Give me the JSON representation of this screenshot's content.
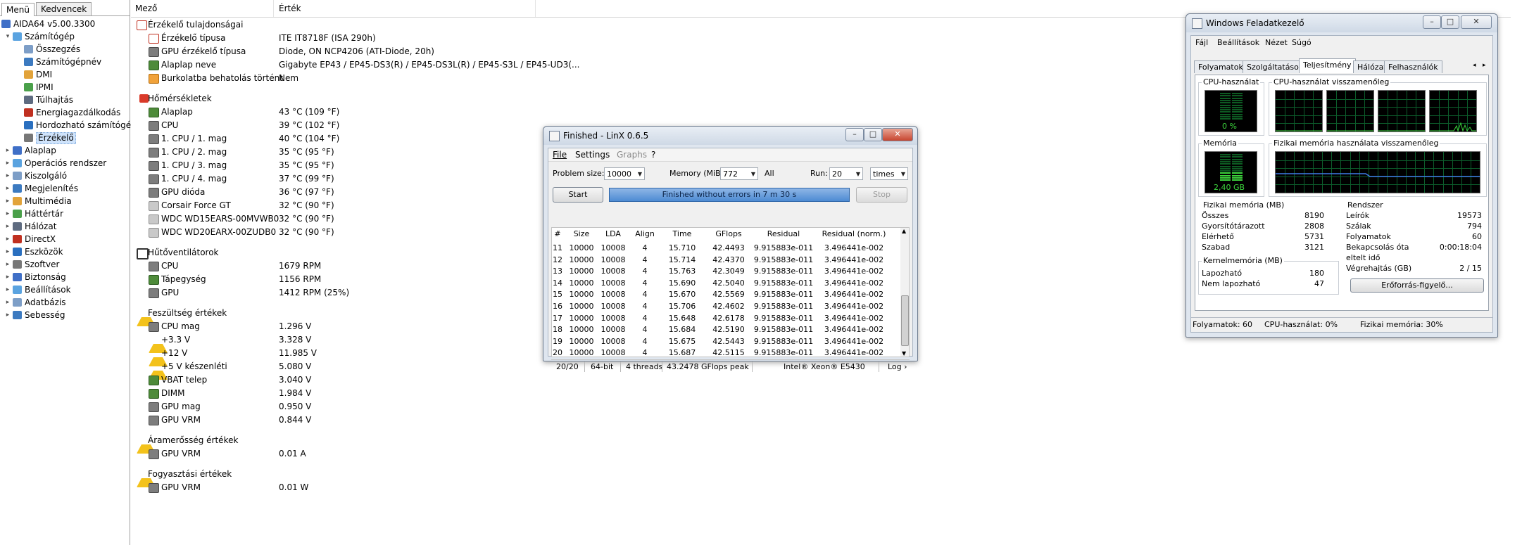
{
  "left": {
    "tabs": [
      "Menü",
      "Kedvencek"
    ],
    "tree": [
      {
        "label": "AIDA64 v5.00.3300",
        "level": 0,
        "icon": "aida64-icon",
        "exp": ""
      },
      {
        "label": "Számítógép",
        "level": 1,
        "icon": "computer-icon",
        "exp": "▾"
      },
      {
        "label": "Összegzés",
        "level": 2,
        "icon": "summary-icon",
        "exp": ""
      },
      {
        "label": "Számítógépnév",
        "level": 2,
        "icon": "computer-name-icon",
        "exp": ""
      },
      {
        "label": "DMI",
        "level": 2,
        "icon": "dmi-icon",
        "exp": ""
      },
      {
        "label": "IPMI",
        "level": 2,
        "icon": "ipmi-icon",
        "exp": ""
      },
      {
        "label": "Túlhajtás",
        "level": 2,
        "icon": "overclock-icon",
        "exp": ""
      },
      {
        "label": "Energiagazdálkodás",
        "level": 2,
        "icon": "power-icon",
        "exp": ""
      },
      {
        "label": "Hordozható számítógé",
        "level": 2,
        "icon": "laptop-icon",
        "exp": ""
      },
      {
        "label": "Érzékelő",
        "level": 2,
        "icon": "sensor-icon",
        "exp": "",
        "selected": true
      },
      {
        "label": "Alaplap",
        "level": 1,
        "icon": "motherboard-icon",
        "exp": "▸"
      },
      {
        "label": "Operációs rendszer",
        "level": 1,
        "icon": "windows-icon",
        "exp": "▸"
      },
      {
        "label": "Kiszolgáló",
        "level": 1,
        "icon": "server-icon",
        "exp": "▸"
      },
      {
        "label": "Megjelenítés",
        "level": 1,
        "icon": "display-icon",
        "exp": "▸"
      },
      {
        "label": "Multimédia",
        "level": 1,
        "icon": "multimedia-icon",
        "exp": "▸"
      },
      {
        "label": "Háttértár",
        "level": 1,
        "icon": "storage-icon",
        "exp": "▸"
      },
      {
        "label": "Hálózat",
        "level": 1,
        "icon": "network-icon",
        "exp": "▸"
      },
      {
        "label": "DirectX",
        "level": 1,
        "icon": "directx-icon",
        "exp": "▸"
      },
      {
        "label": "Eszközök",
        "level": 1,
        "icon": "devices-icon",
        "exp": "▸"
      },
      {
        "label": "Szoftver",
        "level": 1,
        "icon": "software-icon",
        "exp": "▸"
      },
      {
        "label": "Biztonság",
        "level": 1,
        "icon": "security-icon",
        "exp": "▸"
      },
      {
        "label": "Beállítások",
        "level": 1,
        "icon": "settings-icon",
        "exp": "▸"
      },
      {
        "label": "Adatbázis",
        "level": 1,
        "icon": "database-icon",
        "exp": "▸"
      },
      {
        "label": "Sebesség",
        "level": 1,
        "icon": "benchmark-icon",
        "exp": "▸"
      }
    ]
  },
  "main": {
    "col_field": "Mező",
    "col_value": "Érték",
    "rows": [
      {
        "t": "group",
        "f": "Érzékelő tulajdonságai",
        "v": "",
        "icon": "ico-red",
        "iname": "sensor-props-icon"
      },
      {
        "t": "item",
        "f": "Érzékelő típusa",
        "v": "ITE IT8718F  (ISA 290h)",
        "icon": "ico-red",
        "iname": "sensor-type-icon"
      },
      {
        "t": "item",
        "f": "GPU érzékelő típusa",
        "v": "Diode, ON NCP4206  (ATI-Diode, 20h)",
        "icon": "ico-grey",
        "iname": "gpu-icon"
      },
      {
        "t": "item",
        "f": "Alaplap neve",
        "v": "Gigabyte EP43 / EP45-DS3(R) / EP45-DS3L(R) / EP45-S3L /  EP45-UD3(...",
        "icon": "ico-green",
        "iname": "motherboard-icon"
      },
      {
        "t": "item",
        "f": "Burkolatba behatolás történt",
        "v": "Nem",
        "icon": "ico-orange",
        "iname": "chassis-icon"
      },
      {
        "t": "gap"
      },
      {
        "t": "group",
        "f": "Hőmérsékletek",
        "v": "",
        "icon": "ico-therm",
        "iname": "thermometer-icon"
      },
      {
        "t": "item",
        "f": "Alaplap",
        "v": "43 °C  (109 °F)",
        "icon": "ico-green",
        "iname": "motherboard-icon"
      },
      {
        "t": "item",
        "f": "CPU",
        "v": "39 °C  (102 °F)",
        "icon": "ico-grey",
        "iname": "cpu-icon"
      },
      {
        "t": "item",
        "f": "1. CPU / 1. mag",
        "v": "40 °C  (104 °F)",
        "icon": "ico-grey",
        "iname": "cpu-icon"
      },
      {
        "t": "item",
        "f": "1. CPU / 2. mag",
        "v": "35 °C  (95 °F)",
        "icon": "ico-grey",
        "iname": "cpu-icon"
      },
      {
        "t": "item",
        "f": "1. CPU / 3. mag",
        "v": "35 °C  (95 °F)",
        "icon": "ico-grey",
        "iname": "cpu-icon"
      },
      {
        "t": "item",
        "f": "1. CPU / 4. mag",
        "v": "37 °C  (99 °F)",
        "icon": "ico-grey",
        "iname": "cpu-icon"
      },
      {
        "t": "item",
        "f": "GPU dióda",
        "v": "36 °C  (97 °F)",
        "icon": "ico-grey",
        "iname": "gpu-icon"
      },
      {
        "t": "item",
        "f": "Corsair Force GT",
        "v": "32 °C  (90 °F)",
        "icon": "ico-disk",
        "iname": "disk-icon"
      },
      {
        "t": "item",
        "f": "WDC WD15EARS-00MVWB0",
        "v": "32 °C  (90 °F)",
        "icon": "ico-disk",
        "iname": "disk-icon"
      },
      {
        "t": "item",
        "f": "WDC WD20EARX-00ZUDB0",
        "v": "32 °C  (90 °F)",
        "icon": "ico-disk",
        "iname": "disk-icon"
      },
      {
        "t": "gap"
      },
      {
        "t": "group",
        "f": "Hűtőventilátorok",
        "v": "",
        "icon": "ico-fan",
        "iname": "fan-icon"
      },
      {
        "t": "item",
        "f": "CPU",
        "v": "1679 RPM",
        "icon": "ico-grey",
        "iname": "cpu-icon"
      },
      {
        "t": "item",
        "f": "Tápegység",
        "v": "1156 RPM",
        "icon": "ico-green",
        "iname": "psu-icon"
      },
      {
        "t": "item",
        "f": "GPU",
        "v": "1412 RPM  (25%)",
        "icon": "ico-grey",
        "iname": "gpu-icon"
      },
      {
        "t": "gap"
      },
      {
        "t": "group",
        "f": "Feszültség értékek",
        "v": "",
        "icon": "ico-warn",
        "iname": "warning-icon"
      },
      {
        "t": "item",
        "f": "CPU mag",
        "v": "1.296 V",
        "icon": "ico-grey",
        "iname": "cpu-icon"
      },
      {
        "t": "item",
        "f": "+3.3 V",
        "v": "3.328 V",
        "icon": "ico-warn",
        "iname": "warning-icon"
      },
      {
        "t": "item",
        "f": "+12 V",
        "v": "11.985 V",
        "icon": "ico-warn",
        "iname": "warning-icon"
      },
      {
        "t": "item",
        "f": "+5 V készenléti",
        "v": "5.080 V",
        "icon": "ico-warn",
        "iname": "warning-icon"
      },
      {
        "t": "item",
        "f": "VBAT telep",
        "v": "3.040 V",
        "icon": "ico-green",
        "iname": "battery-icon"
      },
      {
        "t": "item",
        "f": "DIMM",
        "v": "1.984 V",
        "icon": "ico-green",
        "iname": "memory-icon"
      },
      {
        "t": "item",
        "f": "GPU mag",
        "v": "0.950 V",
        "icon": "ico-grey",
        "iname": "gpu-icon"
      },
      {
        "t": "item",
        "f": "GPU VRM",
        "v": "0.844 V",
        "icon": "ico-grey",
        "iname": "gpu-icon"
      },
      {
        "t": "gap"
      },
      {
        "t": "group",
        "f": "Áramerősség értékek",
        "v": "",
        "icon": "ico-warn",
        "iname": "warning-icon"
      },
      {
        "t": "item",
        "f": "GPU VRM",
        "v": "0.01 A",
        "icon": "ico-grey",
        "iname": "gpu-icon"
      },
      {
        "t": "gap"
      },
      {
        "t": "group",
        "f": "Fogyasztási értékek",
        "v": "",
        "icon": "ico-warn",
        "iname": "warning-icon"
      },
      {
        "t": "item",
        "f": "GPU VRM",
        "v": "0.01 W",
        "icon": "ico-grey",
        "iname": "gpu-icon"
      }
    ]
  },
  "linx": {
    "title": "Finished - LinX 0.6.5",
    "menu": {
      "file": "File",
      "settings": "Settings",
      "graphs": "Graphs",
      "help": "?"
    },
    "problem_size_label": "Problem size:",
    "problem_size": "10000",
    "memory_label": "Memory (MiB):",
    "memory": "772",
    "all": "All",
    "run_label": "Run:",
    "run": "20",
    "run_unit": "times",
    "start": "Start",
    "stop": "Stop",
    "status": "Finished without errors in 7 m 30 s",
    "headers": [
      "#",
      "Size",
      "LDA",
      "Align",
      "Time",
      "GFlops",
      "Residual",
      "Residual (norm.)"
    ],
    "rows": [
      [
        "11",
        "10000",
        "10008",
        "4",
        "15.710",
        "42.4493",
        "9.915883e-011",
        "3.496441e-002"
      ],
      [
        "12",
        "10000",
        "10008",
        "4",
        "15.714",
        "42.4370",
        "9.915883e-011",
        "3.496441e-002"
      ],
      [
        "13",
        "10000",
        "10008",
        "4",
        "15.763",
        "42.3049",
        "9.915883e-011",
        "3.496441e-002"
      ],
      [
        "14",
        "10000",
        "10008",
        "4",
        "15.690",
        "42.5040",
        "9.915883e-011",
        "3.496441e-002"
      ],
      [
        "15",
        "10000",
        "10008",
        "4",
        "15.670",
        "42.5569",
        "9.915883e-011",
        "3.496441e-002"
      ],
      [
        "16",
        "10000",
        "10008",
        "4",
        "15.706",
        "42.4602",
        "9.915883e-011",
        "3.496441e-002"
      ],
      [
        "17",
        "10000",
        "10008",
        "4",
        "15.648",
        "42.6178",
        "9.915883e-011",
        "3.496441e-002"
      ],
      [
        "18",
        "10000",
        "10008",
        "4",
        "15.684",
        "42.5190",
        "9.915883e-011",
        "3.496441e-002"
      ],
      [
        "19",
        "10000",
        "10008",
        "4",
        "15.675",
        "42.5443",
        "9.915883e-011",
        "3.496441e-002"
      ],
      [
        "20",
        "10000",
        "10008",
        "4",
        "15.687",
        "42.5115",
        "9.915883e-011",
        "3.496441e-002"
      ]
    ],
    "statusbar": {
      "runs": "20/20",
      "bits": "64-bit",
      "threads": "4 threads",
      "peak": "43.2478 GFlops peak",
      "cpu": "Intel® Xeon® E5430",
      "log": "Log ›"
    }
  },
  "taskmgr": {
    "title": "Windows Feladatkezelő",
    "menu": [
      "Fájl",
      "Beállítások",
      "Nézet",
      "Súgó"
    ],
    "tabs": [
      "Folyamatok",
      "Szolgáltatások",
      "Teljesítmény",
      "Hálózat",
      "Felhasználók"
    ],
    "cpu_usage_title": "CPU-használat",
    "cpu_usage_value": "0 %",
    "cpu_history_title": "CPU-használat visszamenőleg",
    "mem_title": "Memória",
    "mem_value": "2,40 GB",
    "mem_history_title": "Fizikai memória használata visszamenőleg",
    "physical": {
      "title": "Fizikai memória (MB)",
      "rows": [
        {
          "n": "Összes",
          "v": "8190"
        },
        {
          "n": "Gyorsítótárazott",
          "v": "2808"
        },
        {
          "n": "Elérhető",
          "v": "5731"
        },
        {
          "n": "Szabad",
          "v": "3121"
        }
      ]
    },
    "kernel": {
      "title": "Kernelmemória (MB)",
      "rows": [
        {
          "n": "Lapozható",
          "v": "180"
        },
        {
          "n": "Nem lapozható",
          "v": "47"
        }
      ]
    },
    "system": {
      "title": "Rendszer",
      "rows": [
        {
          "n": "Leírók",
          "v": "19573"
        },
        {
          "n": "Szálak",
          "v": "794"
        },
        {
          "n": "Folyamatok",
          "v": "60"
        },
        {
          "n": "Bekapcsolás óta",
          "v": "0:00:18:04"
        },
        {
          "n": "eltelt idő",
          "v": ""
        },
        {
          "n": "Végrehajtás (GB)",
          "v": "2 / 15"
        }
      ]
    },
    "resource_monitor": "Erőforrás-figyelő...",
    "status": {
      "procs": "Folyamatok: 60",
      "cpu": "CPU-használat: 0%",
      "mem": "Fizikai memória: 30%"
    }
  }
}
